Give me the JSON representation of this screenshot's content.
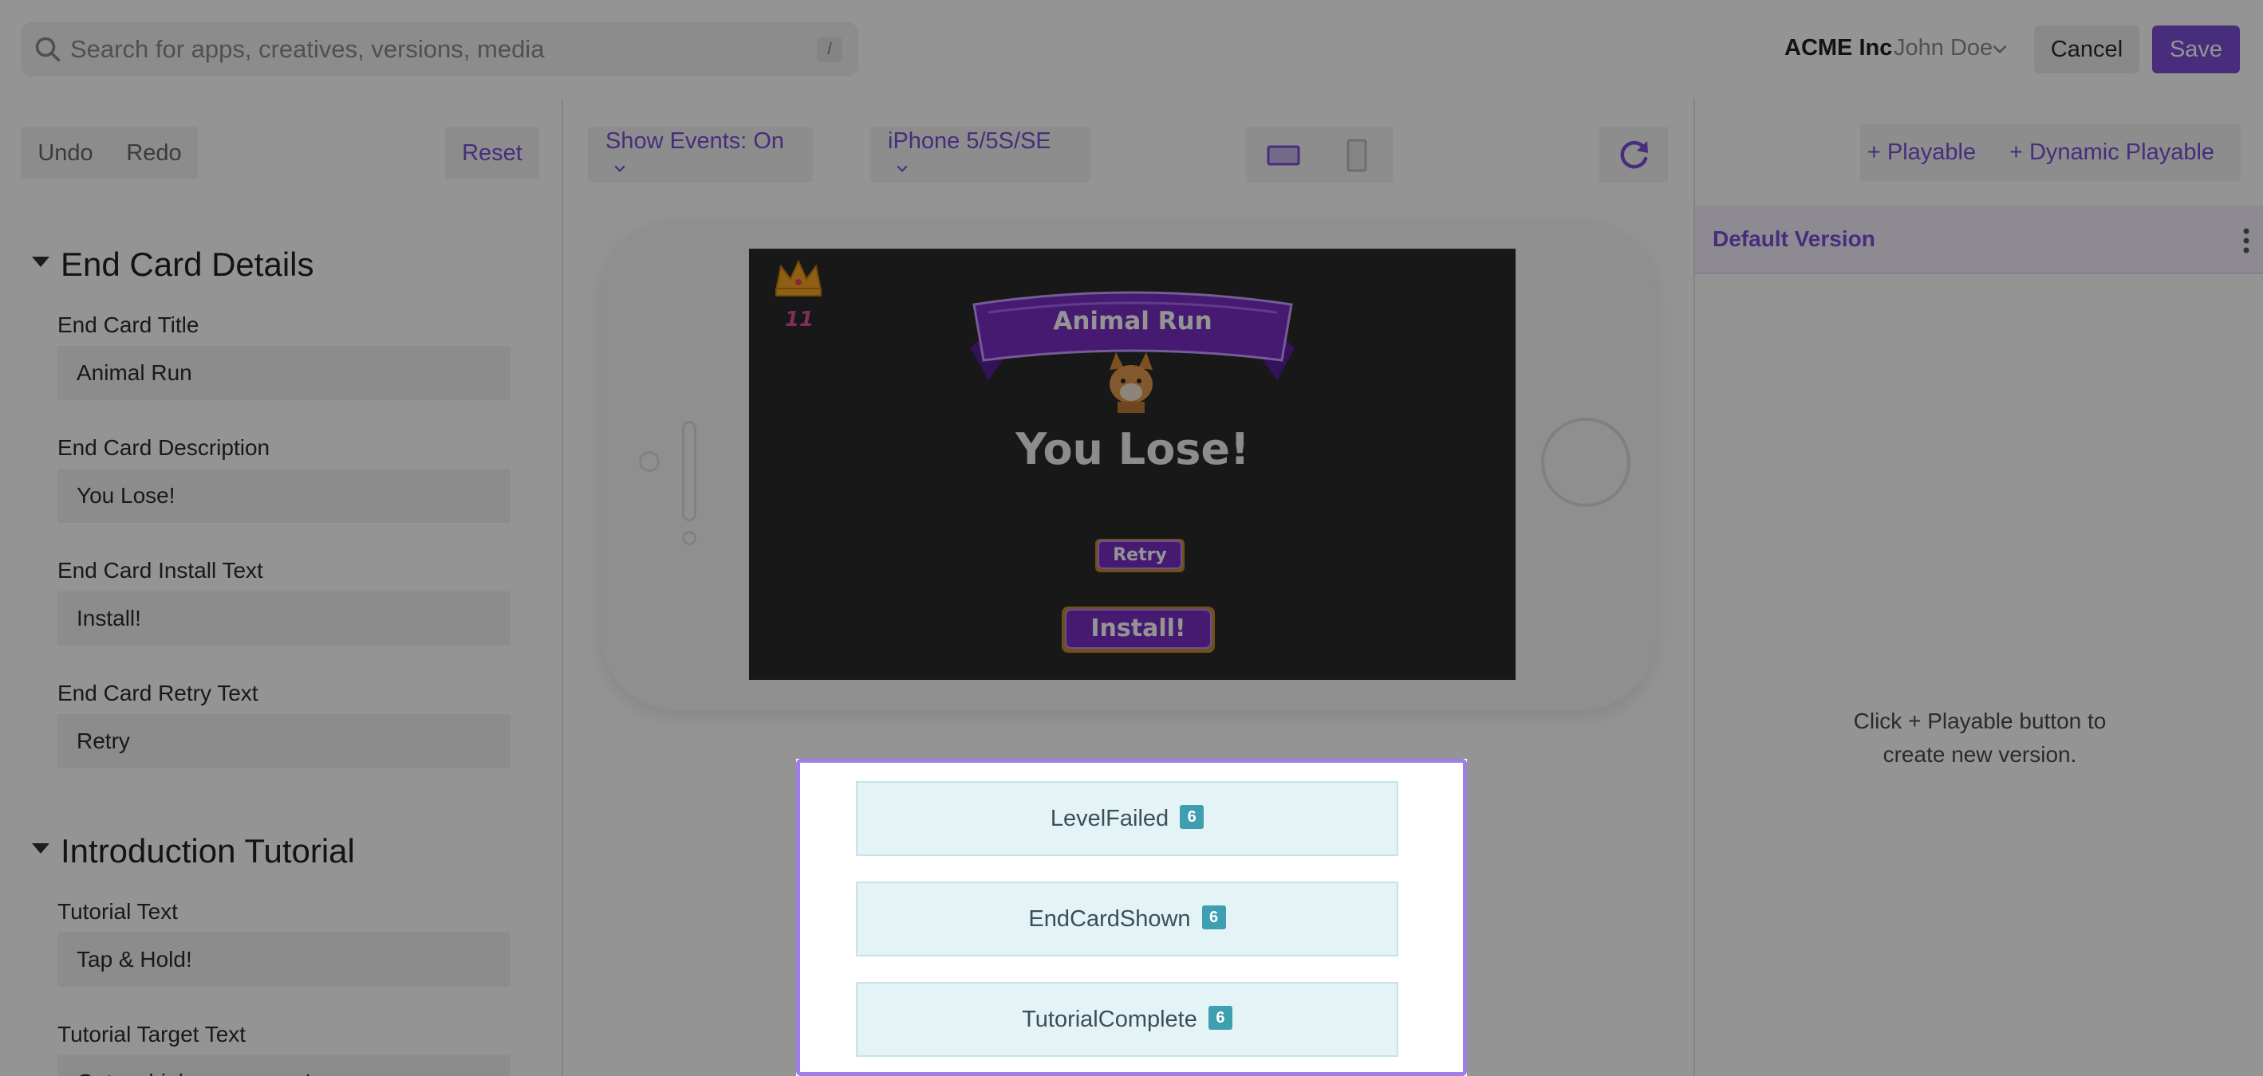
{
  "topbar": {
    "search_placeholder": "Search for apps, creatives, versions, media",
    "search_shortcut": "/",
    "org_name": "ACME Inc",
    "user_name": "John Doe",
    "cancel_label": "Cancel",
    "save_label": "Save"
  },
  "left_panel": {
    "undo_label": "Undo",
    "redo_label": "Redo",
    "reset_label": "Reset",
    "end_card": {
      "heading": "End Card Details",
      "fields": [
        {
          "label": "End Card Title",
          "value": "Animal Run"
        },
        {
          "label": "End Card Description",
          "value": "You Lose!"
        },
        {
          "label": "End Card Install Text",
          "value": "Install!"
        },
        {
          "label": "End Card Retry Text",
          "value": "Retry"
        }
      ]
    },
    "tutorial": {
      "heading": "Introduction Tutorial",
      "fields": [
        {
          "label": "Tutorial Text",
          "value": "Tap & Hold!"
        },
        {
          "label": "Tutorial Target Text",
          "value": "Get as high as you can!"
        }
      ]
    }
  },
  "center": {
    "show_events_label": "Show Events: On",
    "device_label": "iPhone 5/5S/SE",
    "preview": {
      "score": "11",
      "banner_title": "Animal Run",
      "result_text": "You Lose!",
      "retry_label": "Retry",
      "install_label": "Install!"
    },
    "events": [
      {
        "name": "LevelFailed",
        "count": "6"
      },
      {
        "name": "EndCardShown",
        "count": "6"
      },
      {
        "name": "TutorialComplete",
        "count": "6"
      }
    ]
  },
  "right_panel": {
    "add_playable_label": "+ Playable",
    "add_dynamic_label": "+ Dynamic Playable",
    "version_title": "Default Version",
    "empty_line1": "Click + Playable button to",
    "empty_line2": "create new version."
  },
  "colors": {
    "accent": "#7a4fd6",
    "event_badge": "#3d9fb0",
    "event_bg": "#e3f3f6"
  },
  "icons": [
    "search-icon",
    "chevron-down-icon",
    "landscape-icon",
    "portrait-icon",
    "refresh-icon",
    "kebab-menu-icon",
    "crown-icon",
    "caret-down-icon"
  ]
}
